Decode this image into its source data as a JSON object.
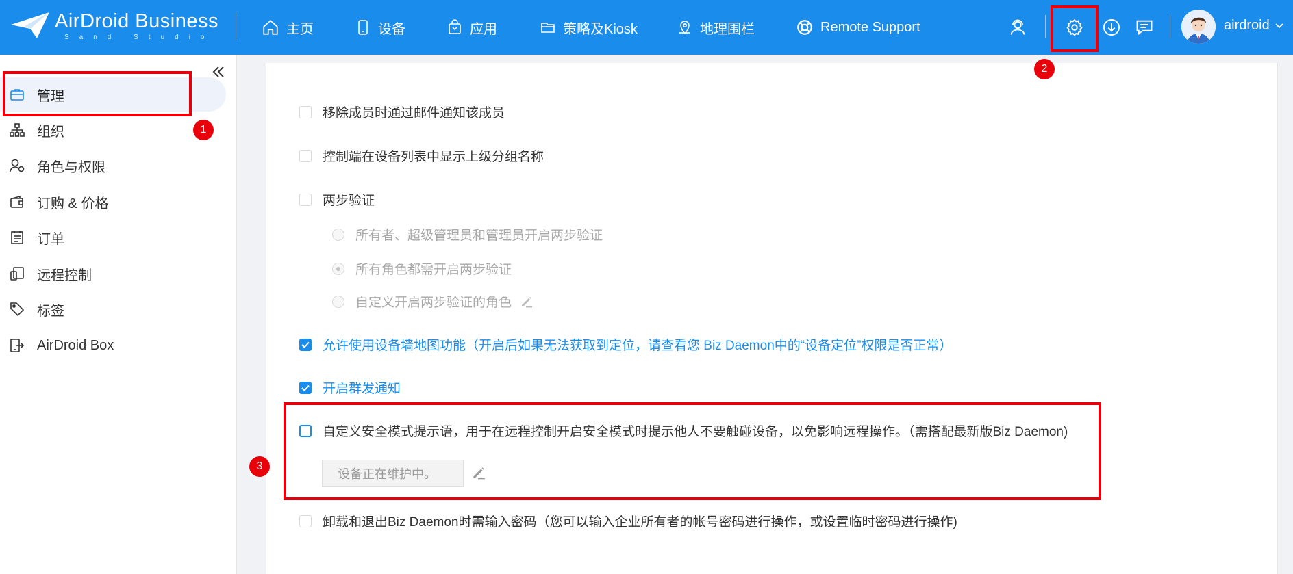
{
  "header": {
    "logo_title": "AirDroid Business",
    "logo_sub": "Sand Studio",
    "nav": [
      {
        "label": "主页",
        "icon": "home-icon"
      },
      {
        "label": "设备",
        "icon": "phone-icon"
      },
      {
        "label": "应用",
        "icon": "app-bag-icon"
      },
      {
        "label": "策略及Kiosk",
        "icon": "folder-icon"
      },
      {
        "label": "地理围栏",
        "icon": "map-pin-icon"
      },
      {
        "label": "Remote Support",
        "icon": "lifebuoy-icon"
      }
    ],
    "username": "airdroid",
    "brand_color": "#1a8dec"
  },
  "sidebar": {
    "items": [
      {
        "label": "管理",
        "icon": "briefcase-icon"
      },
      {
        "label": "组织",
        "icon": "org-tree-icon"
      },
      {
        "label": "角色与权限",
        "icon": "user-role-icon"
      },
      {
        "label": "订购 & 价格",
        "icon": "wallet-icon"
      },
      {
        "label": "订单",
        "icon": "order-list-icon"
      },
      {
        "label": "远程控制",
        "icon": "remote-control-icon"
      },
      {
        "label": "标签",
        "icon": "tag-icon"
      },
      {
        "label": "AirDroid Box",
        "icon": "airdroid-box-icon"
      }
    ]
  },
  "settings": {
    "remove_member_notify": "移除成员时通过邮件通知该成员",
    "show_parent_group": "控制端在设备列表中显示上级分组名称",
    "two_step": "两步验证",
    "two_step_options": [
      "所有者、超级管理员和管理员开启两步验证",
      "所有角色都需开启两步验证",
      "自定义开启两步验证的角色"
    ],
    "device_map": "允许使用设备墙地图功能（开启后如果无法获取到定位，请查看您 Biz Daemon中的“设备定位”权限是否正常）",
    "group_notify": "开启群发通知",
    "safe_mode_tip": "自定义安全模式提示语，用于在远程控制开启安全模式时提示他人不要触碰设备，以免影响远程操作。（需搭配最新版Biz Daemon)",
    "safe_mode_value": "设备正在维护中。",
    "uninstall_password": "卸载和退出Biz Daemon时需输入密码（您可以输入企业所有者的帐号密码进行操作，或设置临时密码进行操作)"
  },
  "annotations": {
    "badge1": "1",
    "badge2": "2",
    "badge3": "3",
    "color": "#e8000b"
  }
}
